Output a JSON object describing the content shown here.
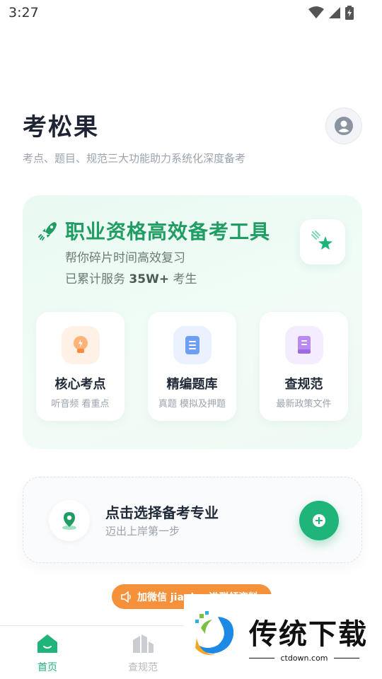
{
  "status_bar": {
    "time": "3:27"
  },
  "header": {
    "title": "考松果",
    "subtitle": "考点、题目、规范三大功能助力系统化深度备考"
  },
  "hero": {
    "title": "职业资格高效备考工具",
    "subtitle": "帮你碎片时间高效复习",
    "served_prefix": "已累计服务 ",
    "served_count": "35W+",
    "served_suffix": " 考生",
    "features": [
      {
        "label": "核心考点",
        "desc": "听音频 看重点",
        "color": "#fff3ea"
      },
      {
        "label": "精编题库",
        "desc": "真题 模拟及押题",
        "color": "#eaf2ff"
      },
      {
        "label": "查规范",
        "desc": "最新政策文件",
        "color": "#f6efff"
      }
    ]
  },
  "major": {
    "title": "点击选择备考专业",
    "subtitle": "迈出上岸第一步"
  },
  "wechat": {
    "label": "加微信 jiaoj... 进群领资料"
  },
  "nav": {
    "items": [
      {
        "label": "首页",
        "active": true
      },
      {
        "label": "查规范",
        "active": false
      }
    ]
  },
  "watermark": {
    "brand": "传统下载",
    "domain": "ctdown.com"
  },
  "colors": {
    "accent": "#1fb57a",
    "orange": "#f5913a"
  }
}
